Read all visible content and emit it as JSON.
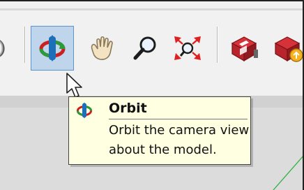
{
  "toolbar": {
    "tools": [
      {
        "name": "partial-tool"
      },
      {
        "name": "orbit",
        "active": true
      },
      {
        "name": "pan"
      },
      {
        "name": "zoom"
      },
      {
        "name": "zoom-extents"
      },
      {
        "name": "3d-warehouse"
      },
      {
        "name": "extension-warehouse"
      }
    ]
  },
  "tooltip": {
    "title": "Orbit",
    "description": "Orbit the camera view about the model."
  },
  "colors": {
    "toolbar_bg": "#f1f1f1",
    "active_tool_bg": "#bfd5ec",
    "active_tool_border": "#5d92d1",
    "viewport_bg": "#dcdcdc",
    "tooltip_bg": "#ffffe1"
  }
}
